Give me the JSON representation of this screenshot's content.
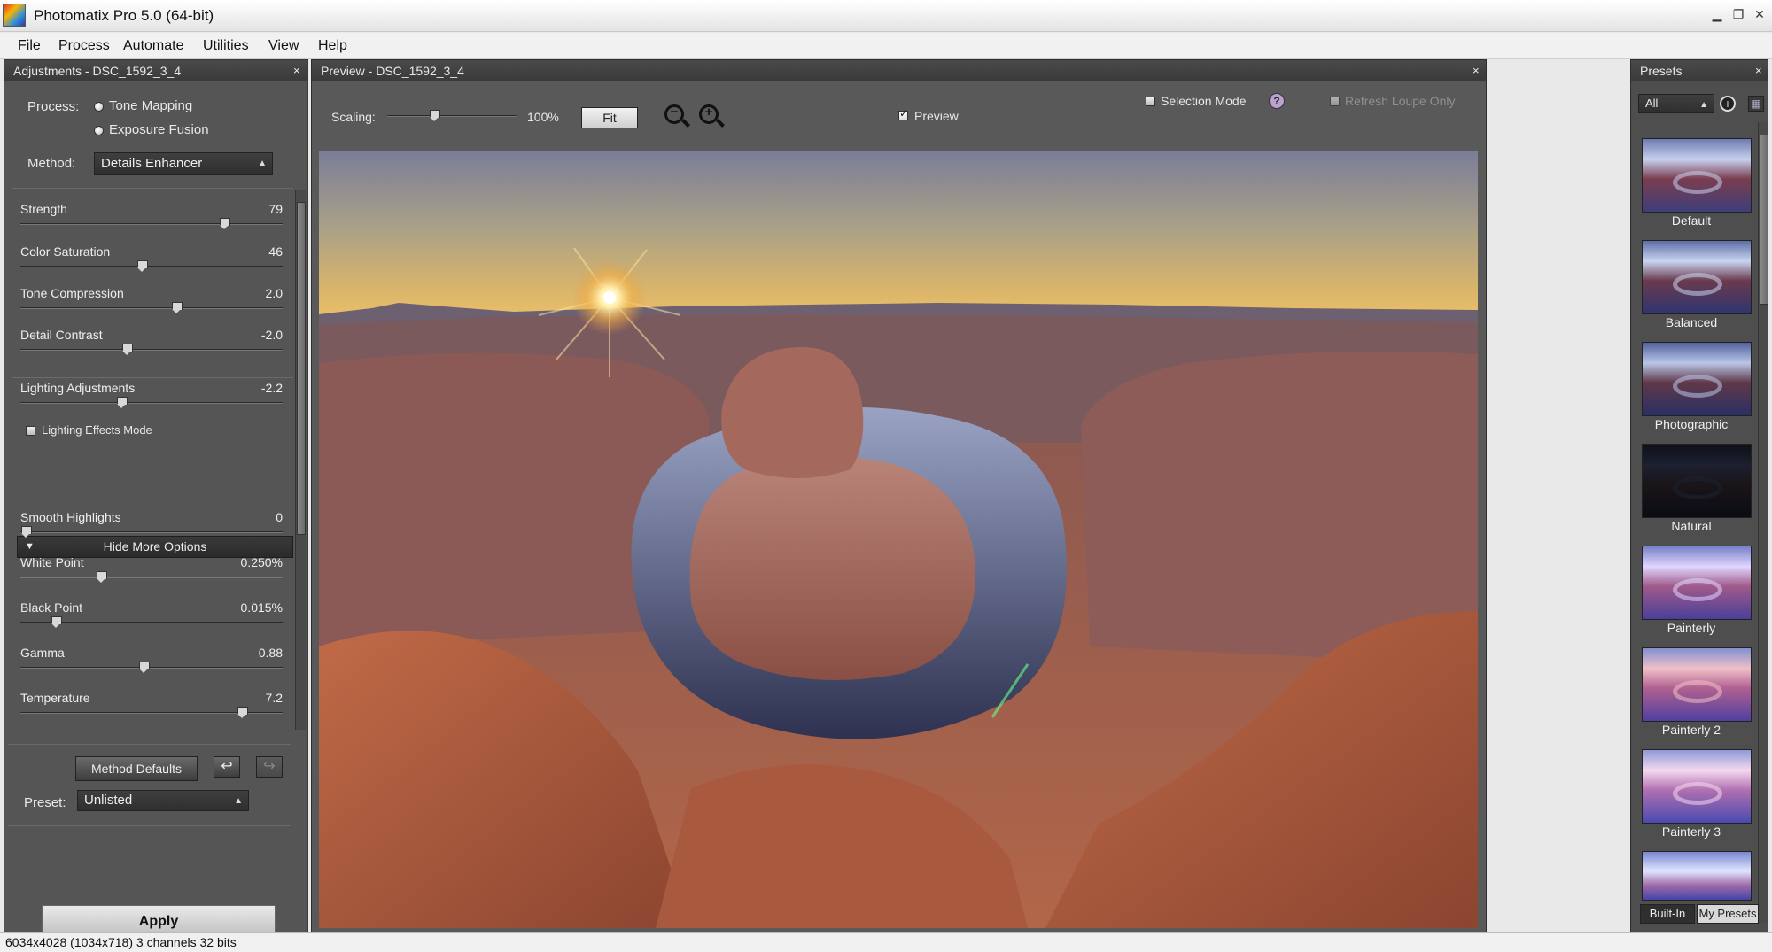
{
  "window": {
    "title": "Photomatix Pro 5.0 (64-bit)",
    "minimize": "▁",
    "restore": "❐",
    "close": "✕"
  },
  "menu": [
    "File",
    "Process",
    "Automate",
    "Utilities",
    "View",
    "Help"
  ],
  "adjustments": {
    "title": "Adjustments - DSC_1592_3_4",
    "close": "×",
    "process_label": "Process:",
    "process_options": [
      "Tone Mapping",
      "Exposure Fusion"
    ],
    "method_label": "Method:",
    "method_value": "Details Enhancer",
    "sliders": [
      {
        "label": "Strength",
        "value": "79",
        "pos": 0.79
      },
      {
        "label": "Color Saturation",
        "value": "46",
        "pos": 0.46
      },
      {
        "label": "Tone Compression",
        "value": "2.0",
        "pos": 0.6
      },
      {
        "label": "Detail Contrast",
        "value": "-2.0",
        "pos": 0.4
      }
    ],
    "lighting": {
      "label": "Lighting Adjustments",
      "value": "-2.2",
      "pos": 0.38,
      "effects_mode": "Lighting Effects Mode"
    },
    "hide_more_options": "Hide More Options",
    "more_sliders": [
      {
        "label": "Smooth Highlights",
        "value": "0",
        "pos": 0.0
      },
      {
        "label": "White Point",
        "value": "0.250%",
        "pos": 0.3
      },
      {
        "label": "Black Point",
        "value": "0.015%",
        "pos": 0.12
      },
      {
        "label": "Gamma",
        "value": "0.88",
        "pos": 0.47
      },
      {
        "label": "Temperature",
        "value": "7.2",
        "pos": 0.86
      }
    ],
    "method_defaults": "Method Defaults",
    "undo_icon": "↩",
    "redo_icon": "↪",
    "preset_label": "Preset:",
    "preset_value": "Unlisted",
    "apply": "Apply",
    "expand_icon": "▶",
    "help": "?"
  },
  "preview": {
    "title": "Preview - DSC_1592_3_4",
    "close": "×",
    "scaling_label": "Scaling:",
    "scaling_value": "100%",
    "scaling_level": 0.35,
    "fit": "Fit",
    "zoom_out": "−",
    "zoom_in": "+",
    "preview_label": "Preview",
    "selection_mode": "Selection Mode",
    "help": "?",
    "refresh_loupe": "Refresh Loupe Only"
  },
  "presets": {
    "title": "Presets",
    "close": "×",
    "filter_value": "All",
    "items": [
      "Default",
      "Balanced",
      "Photographic",
      "Natural",
      "Painterly",
      "Painterly 2",
      "Painterly 3"
    ],
    "tabs": [
      "Built-In",
      "My Presets"
    ]
  },
  "status": "6034x4028 (1034x718) 3 channels 32 bits",
  "colors": {
    "panel": "#555555",
    "panel_dark": "#3a3a3a",
    "sky_top": "#7c7f9a",
    "sky_glow": "#e6c070",
    "rock": "#9b5a4c",
    "river": "#4a4f6e"
  }
}
